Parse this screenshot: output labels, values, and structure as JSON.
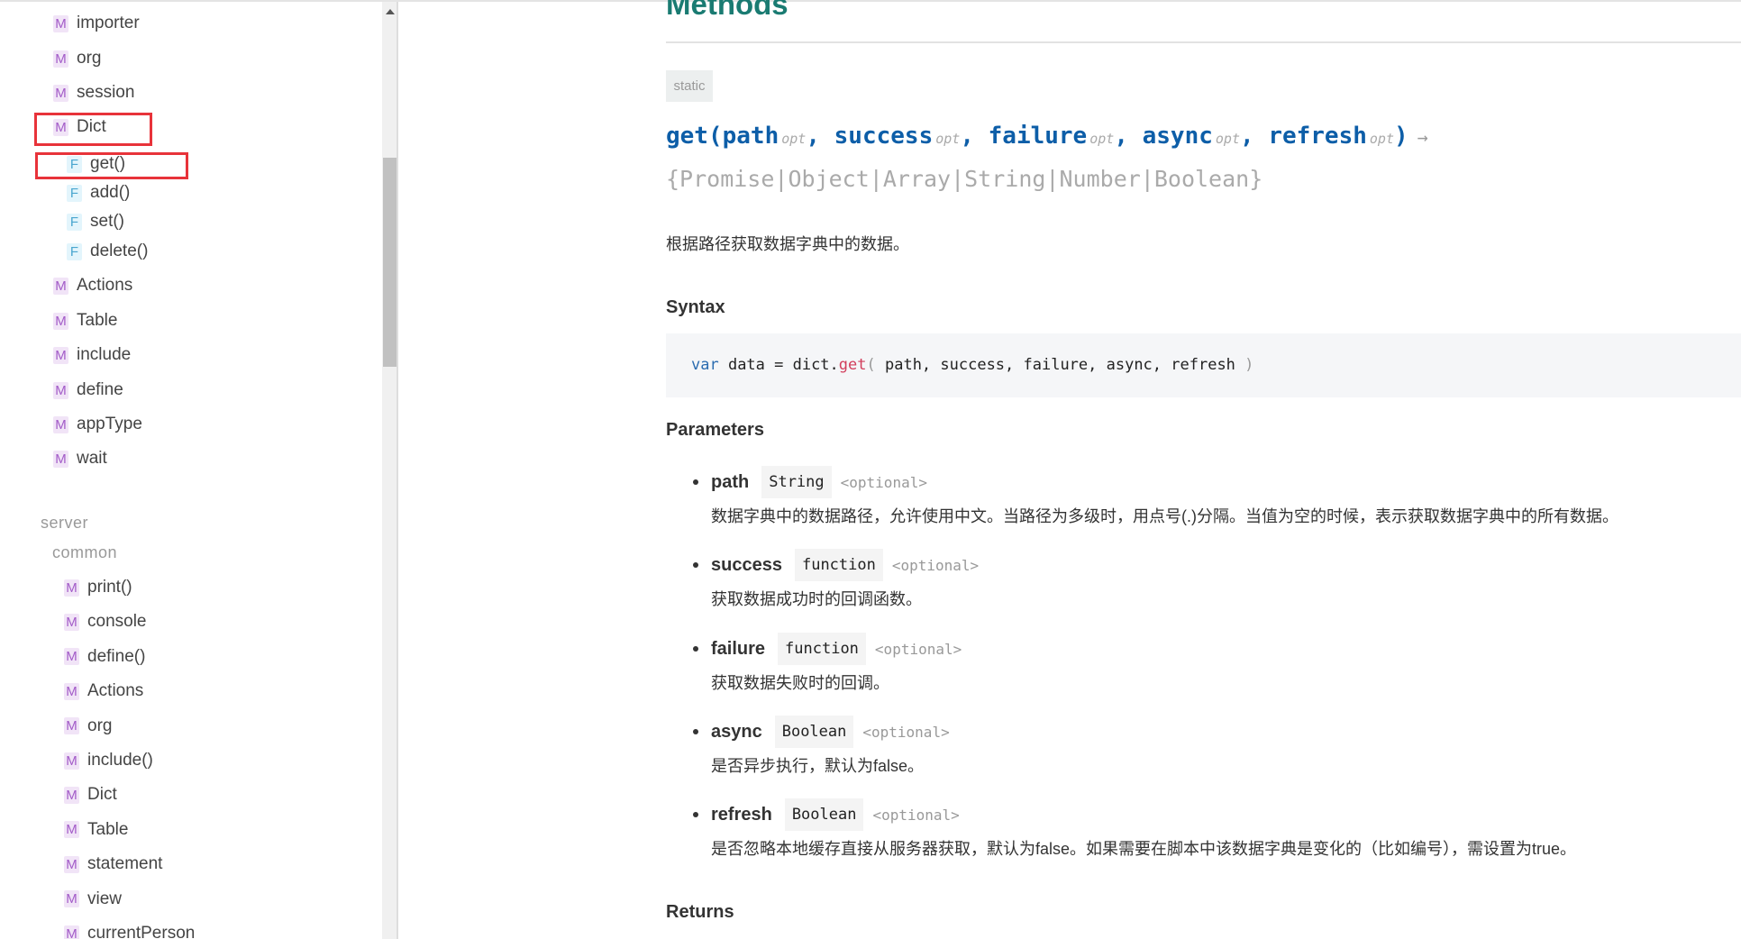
{
  "sidebar": {
    "top_items": [
      {
        "badge": "M",
        "label": "importer"
      },
      {
        "badge": "M",
        "label": "org"
      },
      {
        "badge": "M",
        "label": "session"
      },
      {
        "badge": "M",
        "label": "Dict"
      }
    ],
    "dict_children": [
      {
        "badge": "F",
        "label": "get()"
      },
      {
        "badge": "F",
        "label": "add()"
      },
      {
        "badge": "F",
        "label": "set()"
      },
      {
        "badge": "F",
        "label": "delete()"
      }
    ],
    "more_items": [
      {
        "badge": "M",
        "label": "Actions"
      },
      {
        "badge": "M",
        "label": "Table"
      },
      {
        "badge": "M",
        "label": "include"
      },
      {
        "badge": "M",
        "label": "define"
      },
      {
        "badge": "M",
        "label": "appType"
      },
      {
        "badge": "M",
        "label": "wait"
      }
    ],
    "group": "server",
    "subgroup": "common",
    "server_items": [
      {
        "badge": "M",
        "label": "print()"
      },
      {
        "badge": "M",
        "label": "console"
      },
      {
        "badge": "M",
        "label": "define()"
      },
      {
        "badge": "M",
        "label": "Actions"
      },
      {
        "badge": "M",
        "label": "org"
      },
      {
        "badge": "M",
        "label": "include()"
      },
      {
        "badge": "M",
        "label": "Dict"
      },
      {
        "badge": "M",
        "label": "Table"
      },
      {
        "badge": "M",
        "label": "statement"
      },
      {
        "badge": "M",
        "label": "view"
      },
      {
        "badge": "M",
        "label": "currentPerson"
      }
    ]
  },
  "main": {
    "heading": "Methods",
    "static_badge": "static",
    "signature": {
      "name": "get(",
      "params": [
        "path",
        "success",
        "failure",
        "async",
        "refresh"
      ],
      "opt": "opt",
      "close": ")",
      "arrow": "→"
    },
    "return_type": "{Promise|Object|Array|String|Number|Boolean}",
    "description": "根据路径获取数据字典中的数据。",
    "syntax_title": "Syntax",
    "code": {
      "kw": "var",
      "pre": " data = dict.",
      "fn": "get",
      "open": "( ",
      "args": "path, success, failure, async, refresh",
      "close": " )"
    },
    "parameters_title": "Parameters",
    "parameters": [
      {
        "name": "path",
        "type": "String",
        "optional": "<optional>",
        "desc": "数据字典中的数据路径，允许使用中文。当路径为多级时，用点号(.)分隔。当值为空的时候，表示获取数据字典中的所有数据。"
      },
      {
        "name": "success",
        "type": "function",
        "optional": "<optional>",
        "desc": "获取数据成功时的回调函数。"
      },
      {
        "name": "failure",
        "type": "function",
        "optional": "<optional>",
        "desc": "获取数据失败时的回调。"
      },
      {
        "name": "async",
        "type": "Boolean",
        "optional": "<optional>",
        "desc": "是否异步执行，默认为false。"
      },
      {
        "name": "refresh",
        "type": "Boolean",
        "optional": "<optional>",
        "desc": "是否忽略本地缓存直接从服务器获取，默认为false。如果需要在脚本中该数据字典是变化的（比如编号），需设置为true。"
      }
    ],
    "returns_title": "Returns"
  },
  "colors": {
    "accent": "#1a7b72",
    "signature": "#0d5ea8",
    "highlight": "#e8333a"
  }
}
